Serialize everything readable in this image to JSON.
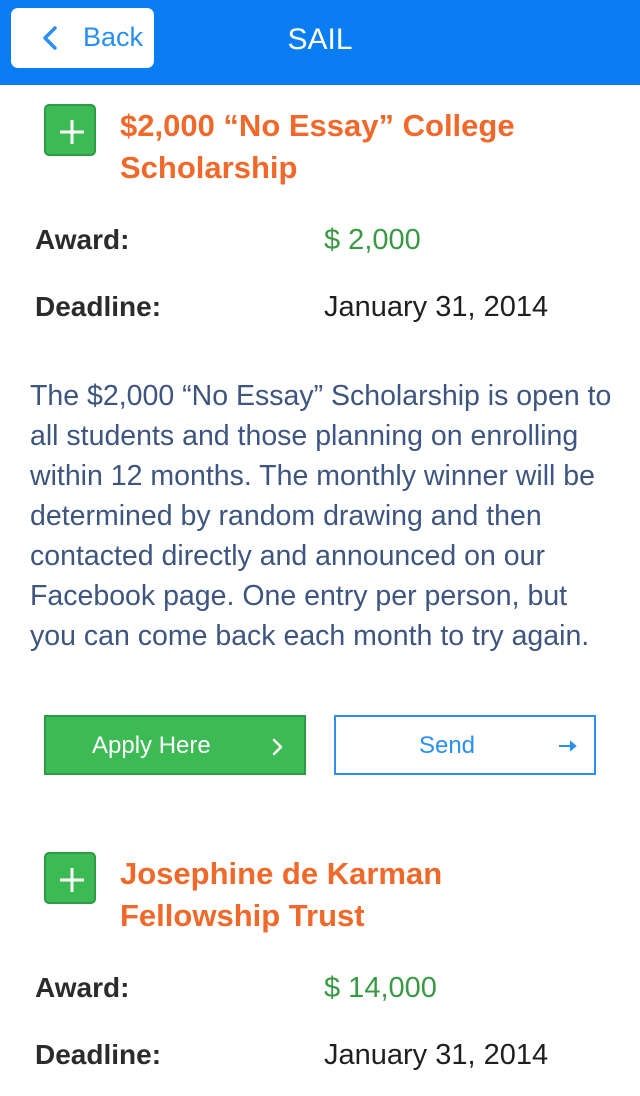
{
  "navbar": {
    "back_label": "Back",
    "title": "SAIL",
    "background_color": "#0a7df3"
  },
  "labels": {
    "award": "Award:",
    "deadline": "Deadline:"
  },
  "scholarships": [
    {
      "title": "$2,000 “No Essay” College Scholarship",
      "award": "$ 2,000",
      "deadline": "January 31, 2014",
      "description": "The $2,000 “No Essay” Scholarship is open to all students and those planning on enrolling within 12 months. The monthly winner will be determined by random drawing and then contacted directly and announced on our Facebook page. One entry per person, but you can come back each month to try again.",
      "apply_label": "Apply Here",
      "send_label": "Send"
    },
    {
      "title": "Josephine de Karman Fellowship Trust",
      "award": "$ 14,000",
      "deadline": "January 31, 2014"
    }
  ],
  "icons": {
    "back": "chevron-left-icon",
    "add": "plus-icon",
    "apply": "chevron-right-icon",
    "send": "arrow-right-icon"
  },
  "colors": {
    "title": "#f0692a",
    "award": "#3a9a44",
    "button_green": "#3cba54",
    "link_blue": "#2a8ff3",
    "description": "#3d5580"
  }
}
